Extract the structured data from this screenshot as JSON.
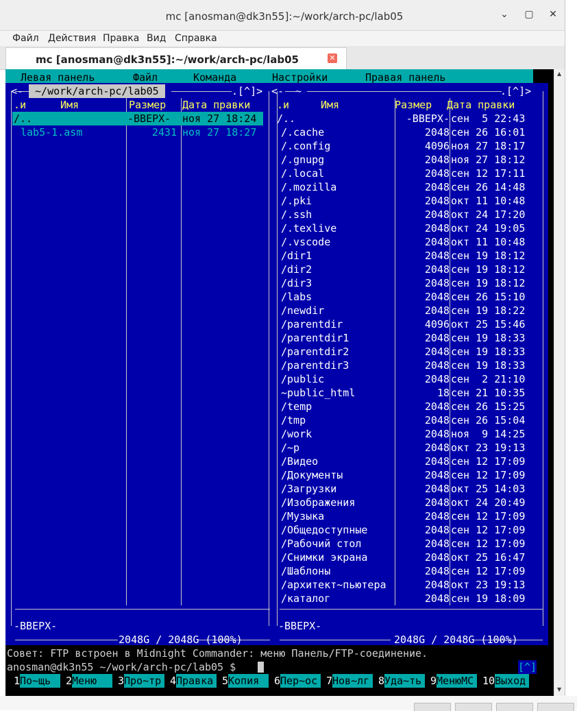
{
  "window": {
    "title": "mc [anosman@dk3n55]:~/work/arch-pc/lab05",
    "minimize": "⌄",
    "maximize": "▢",
    "close": "✕"
  },
  "menu": [
    "Файл",
    "Действия",
    "Правка",
    "Вид",
    "Справка"
  ],
  "tab": {
    "label": "mc [anosman@dk3n55]:~/work/arch-pc/lab05",
    "close": "✕"
  },
  "mc_menu": [
    "Левая панель",
    "Файл",
    "Команда",
    "Настройки",
    "Правая панель"
  ],
  "left_panel": {
    "path": " ~/work/arch-pc/lab05 ",
    "hist": ".[^]>",
    "corner_l": "<-",
    "headers": {
      "n": ".и",
      "name": "Имя",
      "size": "Размер",
      "date": "Дата правки"
    },
    "rows": [
      {
        "name": "/..",
        "size": "-ВВЕРХ-",
        "date": "ноя 27 18:24"
      },
      {
        "name": "lab5-1.asm",
        "size": "2431",
        "date": "ноя 27 18:27"
      }
    ],
    "mini": "-ВВЕРХ-",
    "space": " 2048G / 2048G (100%) "
  },
  "right_panel": {
    "path": " ~ ",
    "hist": ".[^]>",
    "corner_l": "<-",
    "headers": {
      "n": ".и",
      "name": "Имя",
      "size": "Размер",
      "date": "Дата правки"
    },
    "rows": [
      {
        "name": "/..",
        "size": "-ВВЕРХ-",
        "date": "сен  5 22:43"
      },
      {
        "name": "/.cache",
        "size": "2048",
        "date": "сен 26 16:01"
      },
      {
        "name": "/.config",
        "size": "4096",
        "date": "ноя 27 18:17"
      },
      {
        "name": "/.gnupg",
        "size": "2048",
        "date": "ноя 27 18:12"
      },
      {
        "name": "/.local",
        "size": "2048",
        "date": "сен 12 17:11"
      },
      {
        "name": "/.mozilla",
        "size": "2048",
        "date": "сен 26 14:48"
      },
      {
        "name": "/.pki",
        "size": "2048",
        "date": "окт 11 10:48"
      },
      {
        "name": "/.ssh",
        "size": "2048",
        "date": "окт 24 17:20"
      },
      {
        "name": "/.texlive",
        "size": "2048",
        "date": "окт 24 19:05"
      },
      {
        "name": "/.vscode",
        "size": "2048",
        "date": "окт 11 10:48"
      },
      {
        "name": "/dir1",
        "size": "2048",
        "date": "сен 19 18:12"
      },
      {
        "name": "/dir2",
        "size": "2048",
        "date": "сен 19 18:12"
      },
      {
        "name": "/dir3",
        "size": "2048",
        "date": "сен 19 18:12"
      },
      {
        "name": "/labs",
        "size": "2048",
        "date": "сен 26 15:10"
      },
      {
        "name": "/newdir",
        "size": "2048",
        "date": "сен 19 18:22"
      },
      {
        "name": "/parentdir",
        "size": "4096",
        "date": "окт 25 15:46"
      },
      {
        "name": "/parentdir1",
        "size": "2048",
        "date": "сен 19 18:33"
      },
      {
        "name": "/parentdir2",
        "size": "2048",
        "date": "сен 19 18:33"
      },
      {
        "name": "/parentdir3",
        "size": "2048",
        "date": "сен 19 18:33"
      },
      {
        "name": "/public",
        "size": "2048",
        "date": "сен  2 21:10"
      },
      {
        "name": "~public_html",
        "size": "18",
        "date": "сен 21 10:35"
      },
      {
        "name": "/temp",
        "size": "2048",
        "date": "сен 26 15:25"
      },
      {
        "name": "/tmp",
        "size": "2048",
        "date": "сен 26 15:04"
      },
      {
        "name": "/work",
        "size": "2048",
        "date": "ноя  9 14:25"
      },
      {
        "name": "/~p",
        "size": "2048",
        "date": "окт 23 19:13"
      },
      {
        "name": "/Видео",
        "size": "2048",
        "date": "сен 12 17:09"
      },
      {
        "name": "/Документы",
        "size": "2048",
        "date": "сен 12 17:09"
      },
      {
        "name": "/Загрузки",
        "size": "2048",
        "date": "окт 25 14:03"
      },
      {
        "name": "/Изображения",
        "size": "2048",
        "date": "окт 24 20:49"
      },
      {
        "name": "/Музыка",
        "size": "2048",
        "date": "сен 12 17:09"
      },
      {
        "name": "/Общедоступные",
        "size": "2048",
        "date": "сен 12 17:09"
      },
      {
        "name": "/Рабочий стол",
        "size": "2048",
        "date": "сен 12 17:09"
      },
      {
        "name": "/Снимки экрана",
        "size": "2048",
        "date": "окт 25 16:47"
      },
      {
        "name": "/Шаблоны",
        "size": "2048",
        "date": "сен 12 17:09"
      },
      {
        "name": "/архитект~пьютера",
        "size": "2048",
        "date": "окт 23 19:13"
      },
      {
        "name": "/каталог",
        "size": "2048",
        "date": "сен 19 18:09"
      }
    ],
    "mini": "-ВВЕРХ-",
    "space": " 2048G / 2048G (100%) "
  },
  "hint": "Совет: FTP встроен в Midnight Commander: меню Панель/FTP-соединение.",
  "prompt": "anosman@dk3n55 ~/work/arch-pc/lab05 $ ",
  "cmd_hist": "[^]",
  "fkeys": [
    {
      "n": "1",
      "label": "По~щь"
    },
    {
      "n": "2",
      "label": "Меню"
    },
    {
      "n": "3",
      "label": "Про~тр"
    },
    {
      "n": "4",
      "label": "Правка"
    },
    {
      "n": "5",
      "label": "Копия"
    },
    {
      "n": "6",
      "label": "Пер~ос"
    },
    {
      "n": "7",
      "label": "Нов~лг"
    },
    {
      "n": "8",
      "label": "Уда~ть"
    },
    {
      "n": "9",
      "label": "МенюMC"
    },
    {
      "n": "10",
      "label": "Выход"
    }
  ],
  "colors": {
    "panel": "#0000aa",
    "cyan": "#00aaaa",
    "highlight": "#ffff55"
  }
}
